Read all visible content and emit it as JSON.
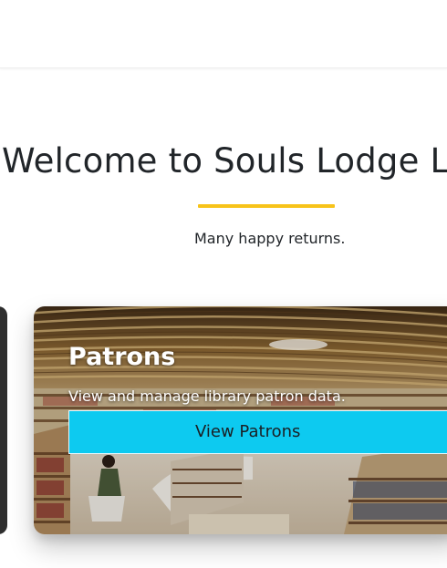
{
  "hero": {
    "title": "Welcome to Souls Lodge Li",
    "subtitle": "Many happy returns."
  },
  "colors": {
    "accent_rule": "#f7c31a",
    "button": "#0dcaf0",
    "dark_card": "#2e2e2e"
  },
  "cards": [
    {
      "title": "Patrons",
      "description": "View and manage library patron data.",
      "button_label": "View Patrons"
    }
  ]
}
